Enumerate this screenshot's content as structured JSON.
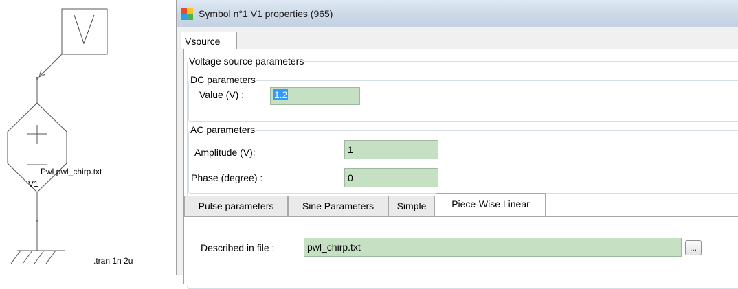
{
  "schematic": {
    "meter_symbol": "V",
    "source_label": "Pwl pwl_chirp.txt",
    "ref_label": "V1",
    "tran_label": ".tran 1n 2u"
  },
  "window": {
    "title": "Symbol n°1 V1 properties (965)",
    "main_tab": "Vsource",
    "voltage_group_title": "Voltage source parameters",
    "dc": {
      "title": "DC parameters",
      "value_label": "Value (V) :",
      "value": "1.2"
    },
    "ac": {
      "title": "AC parameters",
      "amplitude_label": "Amplitude (V):",
      "amplitude_value": "1",
      "phase_label": "Phase (degree) :",
      "phase_value": "0"
    },
    "subtabs": [
      "Pulse parameters",
      "Sine Parameters",
      "Simple",
      "Piece-Wise Linear"
    ],
    "active_subtab": "Piece-Wise Linear",
    "pwl": {
      "file_label": "Described in file :",
      "file_value": "pwl_chirp.txt",
      "browse_label": "..."
    }
  }
}
